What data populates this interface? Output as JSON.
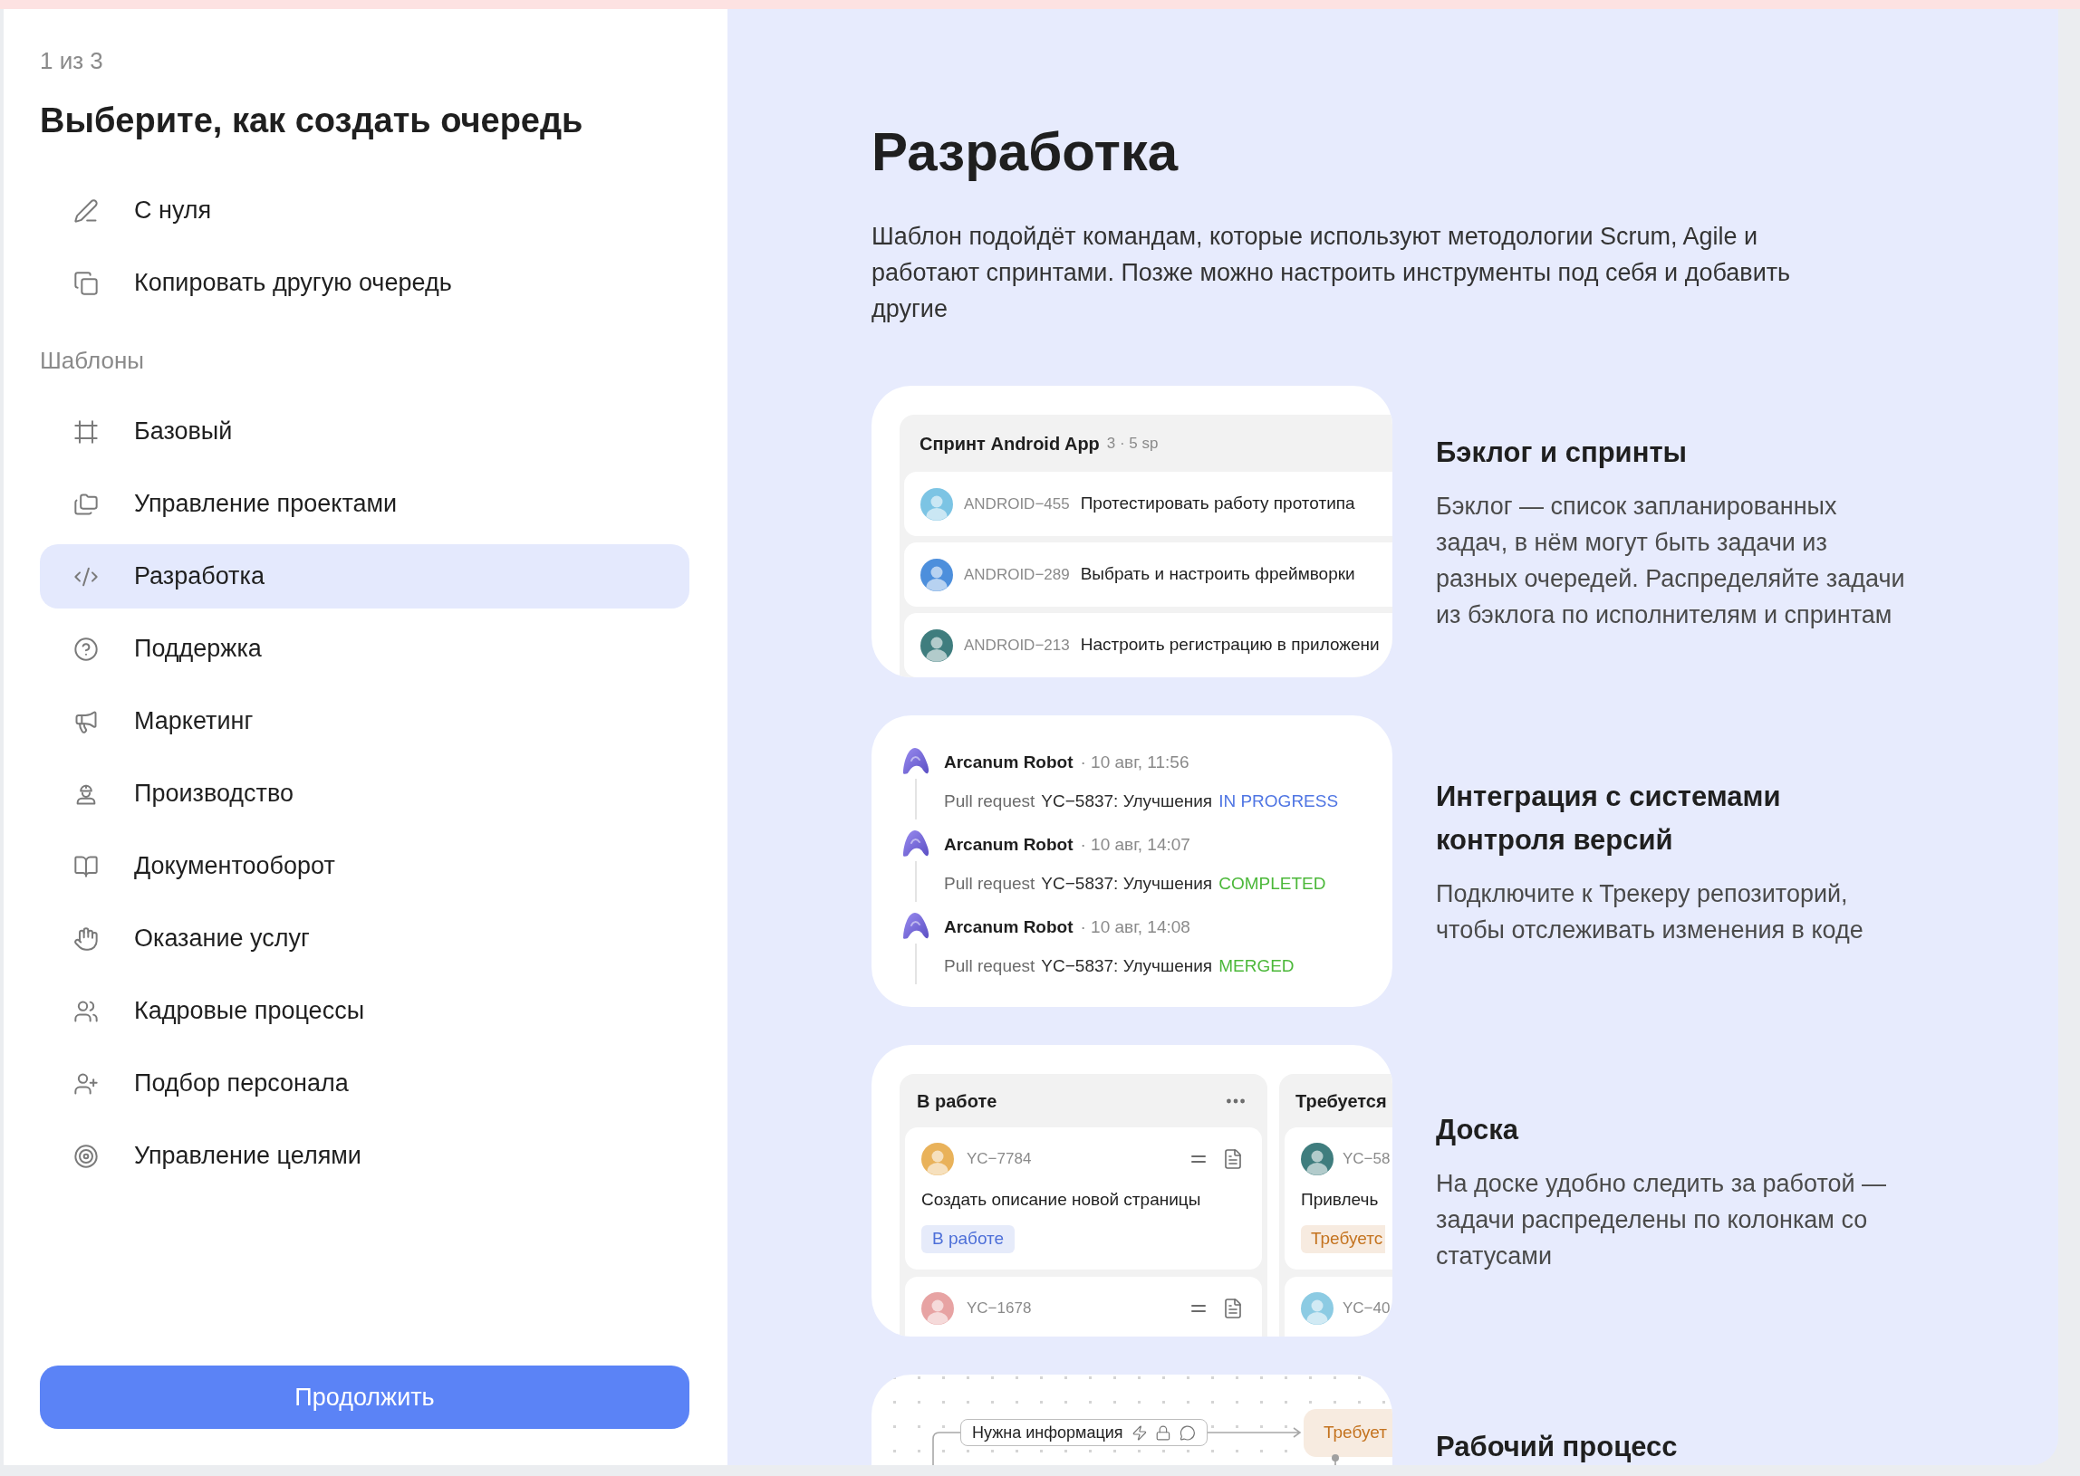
{
  "step": "1 из 3",
  "title": "Выберите, как создать очередь",
  "create_options": [
    {
      "label": "С нуля",
      "selected": false
    },
    {
      "label": "Копировать другую очередь",
      "selected": false
    }
  ],
  "templates": {
    "heading": "Шаблоны",
    "items": [
      {
        "label": "Базовый",
        "selected": false
      },
      {
        "label": "Управление проектами",
        "selected": false
      },
      {
        "label": "Разработка",
        "selected": true
      },
      {
        "label": "Поддержка",
        "selected": false
      },
      {
        "label": "Маркетинг",
        "selected": false
      },
      {
        "label": "Производство",
        "selected": false
      },
      {
        "label": "Документооборот",
        "selected": false
      },
      {
        "label": "Оказание услуг",
        "selected": false
      },
      {
        "label": "Кадровые процессы",
        "selected": false
      },
      {
        "label": "Подбор персонала",
        "selected": false
      },
      {
        "label": "Управление целями",
        "selected": false
      }
    ]
  },
  "continue_button": "Продолжить",
  "template": {
    "title": "Разработка",
    "description": "Шаблон подойдёт командам, которые используют методологии Scrum, Agile и работают спринтами. Позже можно настроить инструменты под себя и добавить другие",
    "features": [
      {
        "kind": "sprint",
        "title": "Бэклог и спринты",
        "description": "Бэклог — список запланированных задач, в нём могут быть задачи из разных очередей. Распределяйте задачи из бэклога по исполнителям и спринтам",
        "preview": {
          "title": "Спринт Android App",
          "meta": "3 · 5 sp",
          "rows": [
            {
              "key": "ANDROID−455",
              "summary": "Протестировать работу прототипа"
            },
            {
              "key": "ANDROID−289",
              "summary": "Выбрать и настроить фреймворки"
            },
            {
              "key": "ANDROID−213",
              "summary": "Настроить регистрацию в приложени"
            }
          ]
        }
      },
      {
        "kind": "vcs",
        "title": "Интеграция с системами контроля версий",
        "description": "Подключите к Трекеру репозиторий, чтобы отслеживать изменения в коде",
        "preview": {
          "events": [
            {
              "author": "Arcanum Robot",
              "time": "· 10 авг, 11:56",
              "action": "Pull request",
              "subject": "YC−5837: Улучшения",
              "status": "IN PROGRESS",
              "color": "#4f75e3"
            },
            {
              "author": "Arcanum Robot",
              "time": "· 10 авг, 14:07",
              "action": "Pull request",
              "subject": "YC−5837: Улучшения",
              "status": "COMPLETED",
              "color": "#4cb83a"
            },
            {
              "author": "Arcanum Robot",
              "time": "· 10 авг, 14:08",
              "action": "Pull request",
              "subject": "YC−5837: Улучшения",
              "status": "MERGED",
              "color": "#4cb83a"
            }
          ]
        }
      },
      {
        "kind": "board",
        "title": "Доска",
        "description": "На доске удобно следить за работой — задачи распределены по колонкам со статусами",
        "preview": {
          "columns": [
            {
              "title": "В работе",
              "clipped": false,
              "cards": [
                {
                  "key": "YC−7784",
                  "summary": "Создать описание новой страницы",
                  "tag": "В работе",
                  "color": "#4d6fd8"
                },
                {
                  "key": "YC−1678"
                }
              ]
            },
            {
              "title": "Требуется",
              "clipped": true,
              "cards": [
                {
                  "key": "YC−58",
                  "summary": "Привлечь",
                  "tag": "Требуетс",
                  "color": "#c4731f"
                },
                {
                  "key": "YC−40"
                }
              ]
            }
          ]
        }
      },
      {
        "kind": "workflow",
        "title": "Рабочий процесс",
        "preview": {
          "transition": "Нужна информация",
          "status": "Требует",
          "color": "#c4731f"
        }
      }
    ]
  }
}
